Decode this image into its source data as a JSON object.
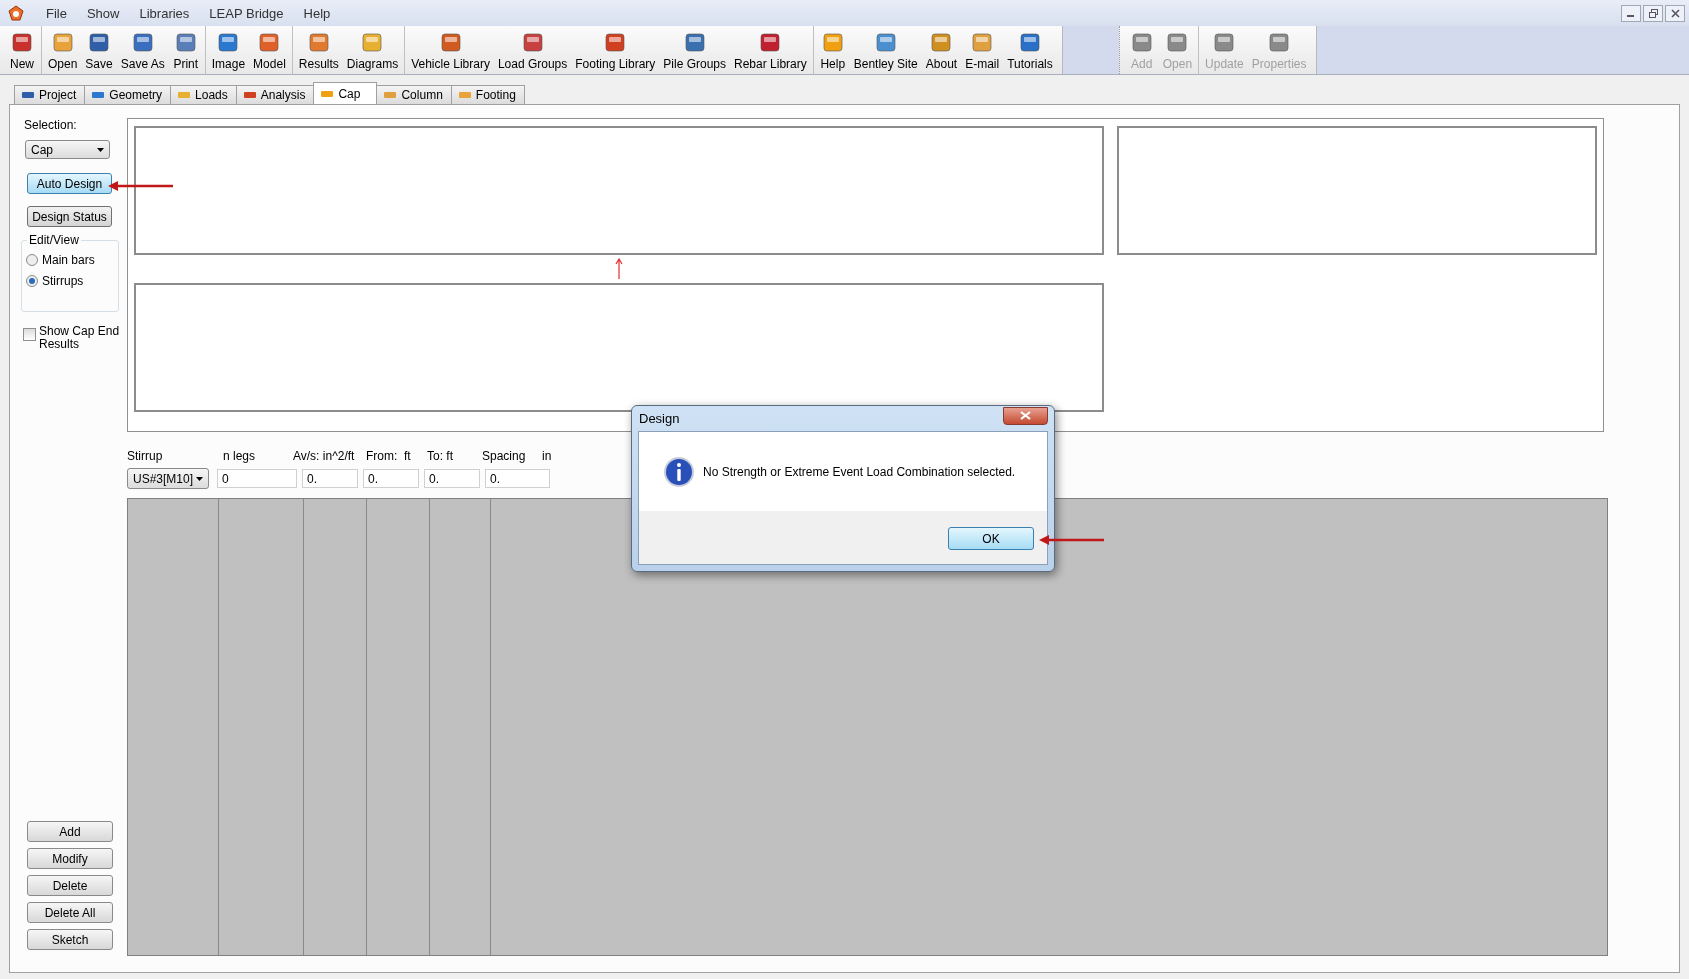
{
  "window": {
    "menu": [
      "File",
      "Show",
      "Libraries",
      "LEAP Bridge",
      "Help"
    ]
  },
  "toolbar": {
    "groups": [
      [
        {
          "label": "New",
          "disabled": false
        }
      ],
      [
        {
          "label": "Open",
          "disabled": false
        },
        {
          "label": "Save",
          "disabled": false
        },
        {
          "label": "Save As",
          "disabled": false
        },
        {
          "label": "Print",
          "disabled": false
        }
      ],
      [
        {
          "label": "Image",
          "disabled": false
        },
        {
          "label": "Model",
          "disabled": false
        }
      ],
      [
        {
          "label": "Results",
          "disabled": false
        },
        {
          "label": "Diagrams",
          "disabled": false
        }
      ],
      [
        {
          "label": "Vehicle Library",
          "disabled": false
        },
        {
          "label": "Load Groups",
          "disabled": false
        },
        {
          "label": "Footing Library",
          "disabled": false
        },
        {
          "label": "Pile Groups",
          "disabled": false
        },
        {
          "label": "Rebar Library",
          "disabled": false
        }
      ],
      [
        {
          "label": "Help",
          "disabled": false
        },
        {
          "label": "Bentley Site",
          "disabled": false
        },
        {
          "label": "About",
          "disabled": false
        },
        {
          "label": "E-mail",
          "disabled": false
        },
        {
          "label": "Tutorials",
          "disabled": false
        }
      ]
    ]
  },
  "secondary_toolbar": {
    "groups": [
      [
        {
          "label": "Add",
          "disabled": true
        },
        {
          "label": "Open",
          "disabled": true
        }
      ],
      [
        {
          "label": "Update",
          "disabled": true
        },
        {
          "label": "Properties",
          "disabled": true
        }
      ]
    ]
  },
  "tabs": [
    {
      "label": "Project",
      "selected": false
    },
    {
      "label": "Geometry",
      "selected": false
    },
    {
      "label": "Loads",
      "selected": false
    },
    {
      "label": "Analysis",
      "selected": false
    },
    {
      "label": "Cap",
      "selected": true
    },
    {
      "label": "Column",
      "selected": false
    },
    {
      "label": "Footing",
      "selected": false
    }
  ],
  "sidebar": {
    "selection_label": "Selection:",
    "selection_value": "Cap",
    "buttons": [
      {
        "label": "Auto Design",
        "highlighted": true
      },
      {
        "label": "Design Status",
        "highlighted": false
      }
    ],
    "edit_view": {
      "title": "Edit/View",
      "options": [
        {
          "label": "Main bars",
          "selected": false
        },
        {
          "label": "Stirrups",
          "selected": true
        }
      ]
    },
    "show_cap_end": {
      "label": "Show Cap End Results",
      "checked": false
    },
    "actions": [
      "Add",
      "Modify",
      "Delete",
      "Delete All",
      "Sketch"
    ]
  },
  "stirrup_form": {
    "labels": [
      "Stirrup",
      "n legs",
      "Av/s: in^2/ft",
      "From:  ft",
      "To: ft",
      "Spacing",
      "in"
    ],
    "stirrup_value": "US#3[M10]",
    "values": [
      "0",
      "0.",
      "0.",
      "0.",
      "0."
    ]
  },
  "dialog": {
    "title": "Design",
    "message": "No Strength or Extreme Event Load Combination selected.",
    "button": "OK"
  }
}
